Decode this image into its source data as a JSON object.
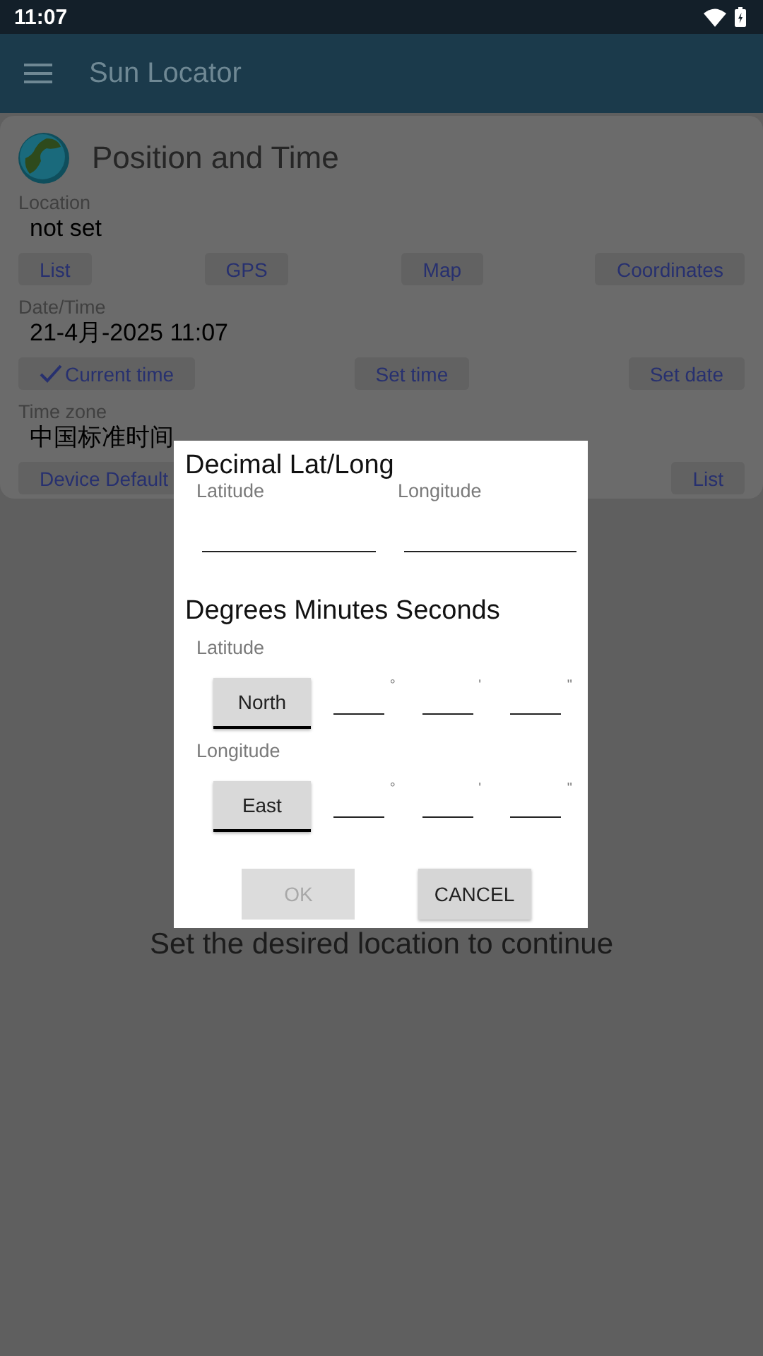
{
  "status_bar": {
    "time": "11:07"
  },
  "app_bar": {
    "title": "Sun Locator"
  },
  "card": {
    "title": "Position and Time",
    "sections": [
      {
        "label": "Location",
        "value": "not set",
        "buttons": [
          {
            "label": "List",
            "checked": false
          },
          {
            "label": "GPS",
            "checked": false
          },
          {
            "label": "Map",
            "checked": false
          },
          {
            "label": "Coordinates",
            "checked": false
          }
        ]
      },
      {
        "label": "Date/Time",
        "value": "21-4月-2025 11:07",
        "buttons": [
          {
            "label": "Current time",
            "checked": true
          },
          {
            "label": "Set time",
            "checked": false
          },
          {
            "label": "Set date",
            "checked": false
          }
        ]
      },
      {
        "label": "Time zone",
        "value": "中国标准时间",
        "buttons": [
          {
            "label": "Device Default",
            "checked": false
          },
          {
            "label": "List",
            "checked": false
          }
        ]
      }
    ]
  },
  "message": "Set the desired location to continue",
  "dialog": {
    "decimal": {
      "title": "Decimal Lat/Long",
      "fields": [
        {
          "label": "Latitude"
        },
        {
          "label": "Longitude"
        }
      ]
    },
    "dms": {
      "title": "Degrees Minutes Seconds",
      "rows": [
        {
          "label": "Latitude",
          "hemisphere": "North",
          "units": [
            "°",
            "'",
            "\""
          ]
        },
        {
          "label": "Longitude",
          "hemisphere": "East",
          "units": [
            "°",
            "'",
            "\""
          ]
        }
      ]
    },
    "buttons": [
      {
        "label": "OK",
        "disabled": true
      },
      {
        "label": "CANCEL",
        "disabled": false
      }
    ]
  }
}
